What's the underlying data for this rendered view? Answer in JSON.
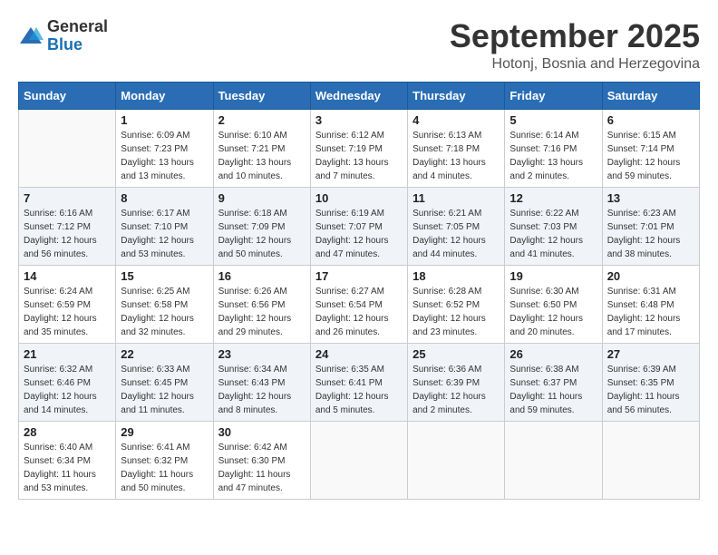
{
  "logo": {
    "general": "General",
    "blue": "Blue"
  },
  "title": "September 2025",
  "location": "Hotonj, Bosnia and Herzegovina",
  "weekdays": [
    "Sunday",
    "Monday",
    "Tuesday",
    "Wednesday",
    "Thursday",
    "Friday",
    "Saturday"
  ],
  "weeks": [
    [
      {
        "day": "",
        "sunrise": "",
        "sunset": "",
        "daylight": ""
      },
      {
        "day": "1",
        "sunrise": "Sunrise: 6:09 AM",
        "sunset": "Sunset: 7:23 PM",
        "daylight": "Daylight: 13 hours and 13 minutes."
      },
      {
        "day": "2",
        "sunrise": "Sunrise: 6:10 AM",
        "sunset": "Sunset: 7:21 PM",
        "daylight": "Daylight: 13 hours and 10 minutes."
      },
      {
        "day": "3",
        "sunrise": "Sunrise: 6:12 AM",
        "sunset": "Sunset: 7:19 PM",
        "daylight": "Daylight: 13 hours and 7 minutes."
      },
      {
        "day": "4",
        "sunrise": "Sunrise: 6:13 AM",
        "sunset": "Sunset: 7:18 PM",
        "daylight": "Daylight: 13 hours and 4 minutes."
      },
      {
        "day": "5",
        "sunrise": "Sunrise: 6:14 AM",
        "sunset": "Sunset: 7:16 PM",
        "daylight": "Daylight: 13 hours and 2 minutes."
      },
      {
        "day": "6",
        "sunrise": "Sunrise: 6:15 AM",
        "sunset": "Sunset: 7:14 PM",
        "daylight": "Daylight: 12 hours and 59 minutes."
      }
    ],
    [
      {
        "day": "7",
        "sunrise": "Sunrise: 6:16 AM",
        "sunset": "Sunset: 7:12 PM",
        "daylight": "Daylight: 12 hours and 56 minutes."
      },
      {
        "day": "8",
        "sunrise": "Sunrise: 6:17 AM",
        "sunset": "Sunset: 7:10 PM",
        "daylight": "Daylight: 12 hours and 53 minutes."
      },
      {
        "day": "9",
        "sunrise": "Sunrise: 6:18 AM",
        "sunset": "Sunset: 7:09 PM",
        "daylight": "Daylight: 12 hours and 50 minutes."
      },
      {
        "day": "10",
        "sunrise": "Sunrise: 6:19 AM",
        "sunset": "Sunset: 7:07 PM",
        "daylight": "Daylight: 12 hours and 47 minutes."
      },
      {
        "day": "11",
        "sunrise": "Sunrise: 6:21 AM",
        "sunset": "Sunset: 7:05 PM",
        "daylight": "Daylight: 12 hours and 44 minutes."
      },
      {
        "day": "12",
        "sunrise": "Sunrise: 6:22 AM",
        "sunset": "Sunset: 7:03 PM",
        "daylight": "Daylight: 12 hours and 41 minutes."
      },
      {
        "day": "13",
        "sunrise": "Sunrise: 6:23 AM",
        "sunset": "Sunset: 7:01 PM",
        "daylight": "Daylight: 12 hours and 38 minutes."
      }
    ],
    [
      {
        "day": "14",
        "sunrise": "Sunrise: 6:24 AM",
        "sunset": "Sunset: 6:59 PM",
        "daylight": "Daylight: 12 hours and 35 minutes."
      },
      {
        "day": "15",
        "sunrise": "Sunrise: 6:25 AM",
        "sunset": "Sunset: 6:58 PM",
        "daylight": "Daylight: 12 hours and 32 minutes."
      },
      {
        "day": "16",
        "sunrise": "Sunrise: 6:26 AM",
        "sunset": "Sunset: 6:56 PM",
        "daylight": "Daylight: 12 hours and 29 minutes."
      },
      {
        "day": "17",
        "sunrise": "Sunrise: 6:27 AM",
        "sunset": "Sunset: 6:54 PM",
        "daylight": "Daylight: 12 hours and 26 minutes."
      },
      {
        "day": "18",
        "sunrise": "Sunrise: 6:28 AM",
        "sunset": "Sunset: 6:52 PM",
        "daylight": "Daylight: 12 hours and 23 minutes."
      },
      {
        "day": "19",
        "sunrise": "Sunrise: 6:30 AM",
        "sunset": "Sunset: 6:50 PM",
        "daylight": "Daylight: 12 hours and 20 minutes."
      },
      {
        "day": "20",
        "sunrise": "Sunrise: 6:31 AM",
        "sunset": "Sunset: 6:48 PM",
        "daylight": "Daylight: 12 hours and 17 minutes."
      }
    ],
    [
      {
        "day": "21",
        "sunrise": "Sunrise: 6:32 AM",
        "sunset": "Sunset: 6:46 PM",
        "daylight": "Daylight: 12 hours and 14 minutes."
      },
      {
        "day": "22",
        "sunrise": "Sunrise: 6:33 AM",
        "sunset": "Sunset: 6:45 PM",
        "daylight": "Daylight: 12 hours and 11 minutes."
      },
      {
        "day": "23",
        "sunrise": "Sunrise: 6:34 AM",
        "sunset": "Sunset: 6:43 PM",
        "daylight": "Daylight: 12 hours and 8 minutes."
      },
      {
        "day": "24",
        "sunrise": "Sunrise: 6:35 AM",
        "sunset": "Sunset: 6:41 PM",
        "daylight": "Daylight: 12 hours and 5 minutes."
      },
      {
        "day": "25",
        "sunrise": "Sunrise: 6:36 AM",
        "sunset": "Sunset: 6:39 PM",
        "daylight": "Daylight: 12 hours and 2 minutes."
      },
      {
        "day": "26",
        "sunrise": "Sunrise: 6:38 AM",
        "sunset": "Sunset: 6:37 PM",
        "daylight": "Daylight: 11 hours and 59 minutes."
      },
      {
        "day": "27",
        "sunrise": "Sunrise: 6:39 AM",
        "sunset": "Sunset: 6:35 PM",
        "daylight": "Daylight: 11 hours and 56 minutes."
      }
    ],
    [
      {
        "day": "28",
        "sunrise": "Sunrise: 6:40 AM",
        "sunset": "Sunset: 6:34 PM",
        "daylight": "Daylight: 11 hours and 53 minutes."
      },
      {
        "day": "29",
        "sunrise": "Sunrise: 6:41 AM",
        "sunset": "Sunset: 6:32 PM",
        "daylight": "Daylight: 11 hours and 50 minutes."
      },
      {
        "day": "30",
        "sunrise": "Sunrise: 6:42 AM",
        "sunset": "Sunset: 6:30 PM",
        "daylight": "Daylight: 11 hours and 47 minutes."
      },
      {
        "day": "",
        "sunrise": "",
        "sunset": "",
        "daylight": ""
      },
      {
        "day": "",
        "sunrise": "",
        "sunset": "",
        "daylight": ""
      },
      {
        "day": "",
        "sunrise": "",
        "sunset": "",
        "daylight": ""
      },
      {
        "day": "",
        "sunrise": "",
        "sunset": "",
        "daylight": ""
      }
    ]
  ]
}
